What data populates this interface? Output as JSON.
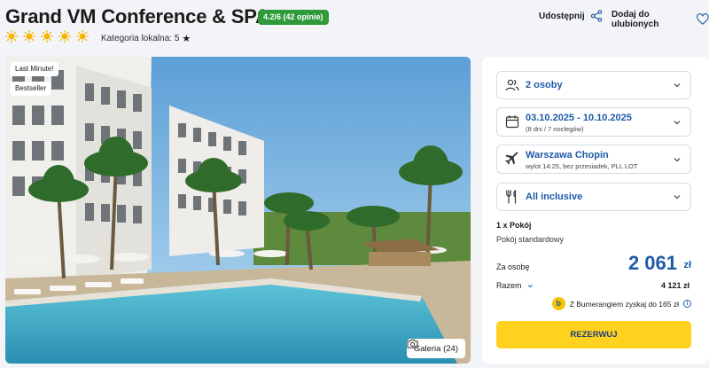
{
  "hotel": {
    "name": "Grand VM Conference & SPA",
    "rating_badge": "4.2/6 (42 opinie)",
    "sun_rating": 5,
    "local_category": "Kategoria lokalna: 5"
  },
  "actions": {
    "share_label": "Udostępnij",
    "favorite_label": "Dodaj do ulubionych"
  },
  "photo": {
    "tags": [
      "Last Minute!",
      "Bestseller"
    ],
    "gallery_label": "Galeria (24)"
  },
  "booking": {
    "persons": "2 osoby",
    "dates": "03.10.2025 - 10.10.2025",
    "duration": "(8 dni / 7 noclegów)",
    "departure": "Warszawa Chopin",
    "flight_info": "wylot 14:25, bez przesiadek, PLL LOT",
    "board": "All inclusive",
    "rooms": "1 x Pokój",
    "room_type": "Pokój standardowy",
    "per_person_label": "Za osobę",
    "price": "2 061",
    "currency": "zł",
    "total_label": "Razem",
    "total_value": "4 121 zł",
    "bumerang_text": "Z Bumerangiem zyskaj do 165 zł",
    "book_button": "REZERWUJ"
  },
  "colors": {
    "accent_blue": "#1e5aa8",
    "rating_green": "#2f9a3a",
    "cta_yellow": "#ffd21f",
    "sun_yellow": "#f7b500"
  }
}
